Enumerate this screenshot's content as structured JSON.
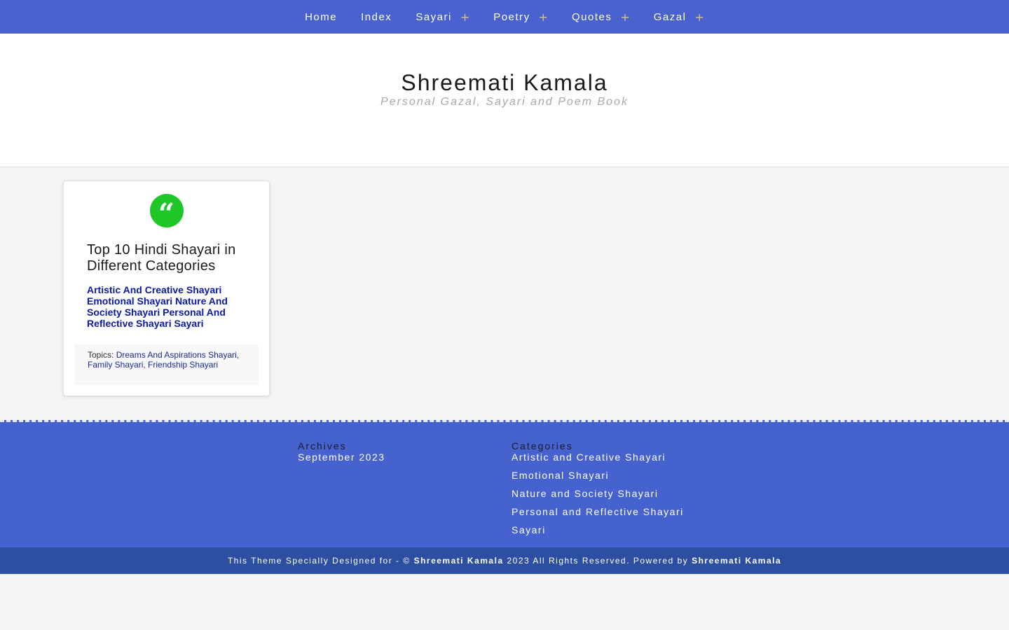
{
  "nav": {
    "items": [
      {
        "label": "Home",
        "has_sub": false
      },
      {
        "label": "Index",
        "has_sub": false
      },
      {
        "label": "Sayari",
        "has_sub": true
      },
      {
        "label": "Poetry",
        "has_sub": true
      },
      {
        "label": "Quotes",
        "has_sub": true
      },
      {
        "label": "Gazal",
        "has_sub": true
      }
    ],
    "submenu_glyph": "+"
  },
  "header": {
    "title": "Shreemati Kamala",
    "tagline": "Personal Gazal, Sayari and Poem Book",
    "social": [
      {
        "icon": "facebook-icon",
        "color": "#3b5998",
        "glyph": ""
      },
      {
        "icon": "instagram-icon",
        "color": "#8a3ab9",
        "glyph": ""
      },
      {
        "icon": "twitter-icon",
        "color": "#1da1f2",
        "glyph": ""
      }
    ]
  },
  "post": {
    "quote_glyph": "“",
    "quote_color": "#1ec727",
    "title": "Top 10 Hindi Shayari in Different Categories",
    "categories": [
      "Artistic And Creative Shayari",
      "Emotional Shayari",
      "Nature And Society Shayari",
      "Personal And Reflective Shayari",
      "Sayari"
    ],
    "topics_label": "Topics:",
    "topics": [
      "Dreams And Aspirations Shayari",
      "Family Shayari",
      "Friendship Shayari"
    ]
  },
  "footer": {
    "archives": {
      "heading": "Archives",
      "items": [
        "September 2023"
      ]
    },
    "categories": {
      "heading": "Categories",
      "items": [
        "Artistic and Creative Shayari",
        "Emotional Shayari",
        "Nature and Society Shayari",
        "Personal and Reflective Shayari",
        "Sayari"
      ]
    },
    "copyright": {
      "prefix": "This Theme Specially Designed for - ©",
      "owner": "Shreemati Kamala",
      "middle": "2023 All Rights Reserved. Powered by",
      "powered": "Shreemati Kamala"
    }
  },
  "colors": {
    "nav_bg": "#4a62d0",
    "footer_bg": "#4662ce",
    "bottombar_bg": "#2d4fa1",
    "category_link": "#0a1aa6"
  }
}
